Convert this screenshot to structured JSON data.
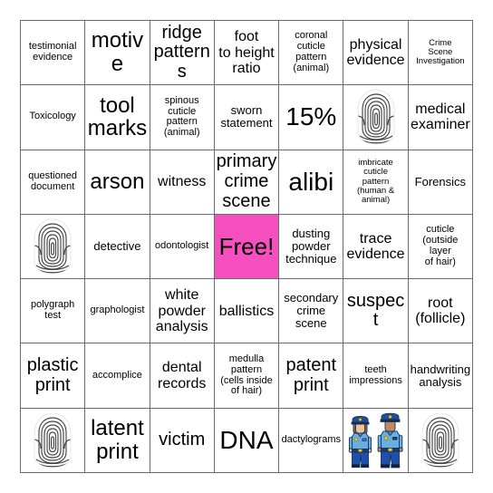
{
  "card": {
    "type": "bingo-card",
    "columns": 7,
    "rows": 7,
    "free_space_color": "#F74FC0",
    "border_color": "#6B6B6B",
    "background_color": "#FFFFFF",
    "free_label": "Free!"
  },
  "cells": [
    {
      "id": "r1c1",
      "text": "testimonial\nevidence",
      "size": "xs",
      "kind": "text"
    },
    {
      "id": "r1c2",
      "text": "motive",
      "size": "xl",
      "kind": "text"
    },
    {
      "id": "r1c3",
      "text": "ridge\npatterns",
      "size": "lg",
      "kind": "text"
    },
    {
      "id": "r1c4",
      "text": "foot\nto height\nratio",
      "size": "md",
      "kind": "text"
    },
    {
      "id": "r1c5",
      "text": "coronal\ncuticle\npattern\n(animal)",
      "size": "xs",
      "kind": "text"
    },
    {
      "id": "r1c6",
      "text": "physical\nevidence",
      "size": "md",
      "kind": "text"
    },
    {
      "id": "r1c7",
      "text": "Crime\nScene\nInvestigation",
      "size": "xxs",
      "kind": "text"
    },
    {
      "id": "r2c1",
      "text": "Toxicology",
      "size": "xs",
      "kind": "text"
    },
    {
      "id": "r2c2",
      "text": "tool\nmarks",
      "size": "xl",
      "kind": "text"
    },
    {
      "id": "r2c3",
      "text": "spinous\ncuticle\npattern\n(animal)",
      "size": "xs",
      "kind": "text"
    },
    {
      "id": "r2c4",
      "text": "sworn\nstatement",
      "size": "sm",
      "kind": "text"
    },
    {
      "id": "r2c5",
      "text": "15%",
      "size": "xxl",
      "kind": "text"
    },
    {
      "id": "r2c6",
      "text": "",
      "size": "md",
      "kind": "fingerprint"
    },
    {
      "id": "r2c7",
      "text": "medical\nexaminer",
      "size": "md",
      "kind": "text"
    },
    {
      "id": "r3c1",
      "text": "questioned\ndocument",
      "size": "xs",
      "kind": "text"
    },
    {
      "id": "r3c2",
      "text": "arson",
      "size": "xl",
      "kind": "text"
    },
    {
      "id": "r3c3",
      "text": "witness",
      "size": "md",
      "kind": "text"
    },
    {
      "id": "r3c4",
      "text": "primary\ncrime\nscene",
      "size": "lg",
      "kind": "text"
    },
    {
      "id": "r3c5",
      "text": "alibi",
      "size": "xxl",
      "kind": "text"
    },
    {
      "id": "r3c6",
      "text": "imbricate\ncuticle\npattern\n(human &\nanimal)",
      "size": "xxs",
      "kind": "text"
    },
    {
      "id": "r3c7",
      "text": "Forensics",
      "size": "sm",
      "kind": "text"
    },
    {
      "id": "r4c1",
      "text": "",
      "size": "md",
      "kind": "fingerprint"
    },
    {
      "id": "r4c2",
      "text": "detective",
      "size": "sm",
      "kind": "text"
    },
    {
      "id": "r4c3",
      "text": "odontologist",
      "size": "xs",
      "kind": "text"
    },
    {
      "id": "r4c4",
      "text": "Free!",
      "size": "xl",
      "kind": "free"
    },
    {
      "id": "r4c5",
      "text": "dusting\npowder\ntechnique",
      "size": "sm",
      "kind": "text"
    },
    {
      "id": "r4c6",
      "text": "trace\nevidence",
      "size": "md",
      "kind": "text"
    },
    {
      "id": "r4c7",
      "text": "cuticle\n(outside\nlayer\nof hair)",
      "size": "xs",
      "kind": "text"
    },
    {
      "id": "r5c1",
      "text": "polygraph\ntest",
      "size": "xs",
      "kind": "text"
    },
    {
      "id": "r5c2",
      "text": "graphologist",
      "size": "xs",
      "kind": "text"
    },
    {
      "id": "r5c3",
      "text": "white\npowder\nanalysis",
      "size": "md",
      "kind": "text"
    },
    {
      "id": "r5c4",
      "text": "ballistics",
      "size": "md",
      "kind": "text"
    },
    {
      "id": "r5c5",
      "text": "secondary\ncrime\nscene",
      "size": "sm",
      "kind": "text"
    },
    {
      "id": "r5c6",
      "text": "suspect",
      "size": "lg",
      "kind": "text"
    },
    {
      "id": "r5c7",
      "text": "root\n(follicle)",
      "size": "md",
      "kind": "text"
    },
    {
      "id": "r6c1",
      "text": "plastic\nprint",
      "size": "lg",
      "kind": "text"
    },
    {
      "id": "r6c2",
      "text": "accomplice",
      "size": "xs",
      "kind": "text"
    },
    {
      "id": "r6c3",
      "text": "dental\nrecords",
      "size": "md",
      "kind": "text"
    },
    {
      "id": "r6c4",
      "text": "medulla\npattern\n(cells inside\nof hair)",
      "size": "xs",
      "kind": "text"
    },
    {
      "id": "r6c5",
      "text": "patent\nprint",
      "size": "lg",
      "kind": "text"
    },
    {
      "id": "r6c6",
      "text": "teeth\nimpressions",
      "size": "xs",
      "kind": "text"
    },
    {
      "id": "r6c7",
      "text": "handwriting\nanalysis",
      "size": "sm",
      "kind": "text"
    },
    {
      "id": "r7c1",
      "text": "",
      "size": "md",
      "kind": "fingerprint"
    },
    {
      "id": "r7c2",
      "text": "latent\nprint",
      "size": "xl",
      "kind": "text"
    },
    {
      "id": "r7c3",
      "text": "victim",
      "size": "lg",
      "kind": "text"
    },
    {
      "id": "r7c4",
      "text": "DNA",
      "size": "xxl",
      "kind": "text"
    },
    {
      "id": "r7c5",
      "text": "dactylograms",
      "size": "xs",
      "kind": "text"
    },
    {
      "id": "r7c6",
      "text": "",
      "size": "md",
      "kind": "officers"
    },
    {
      "id": "r7c7",
      "text": "",
      "size": "md",
      "kind": "fingerprint"
    }
  ]
}
